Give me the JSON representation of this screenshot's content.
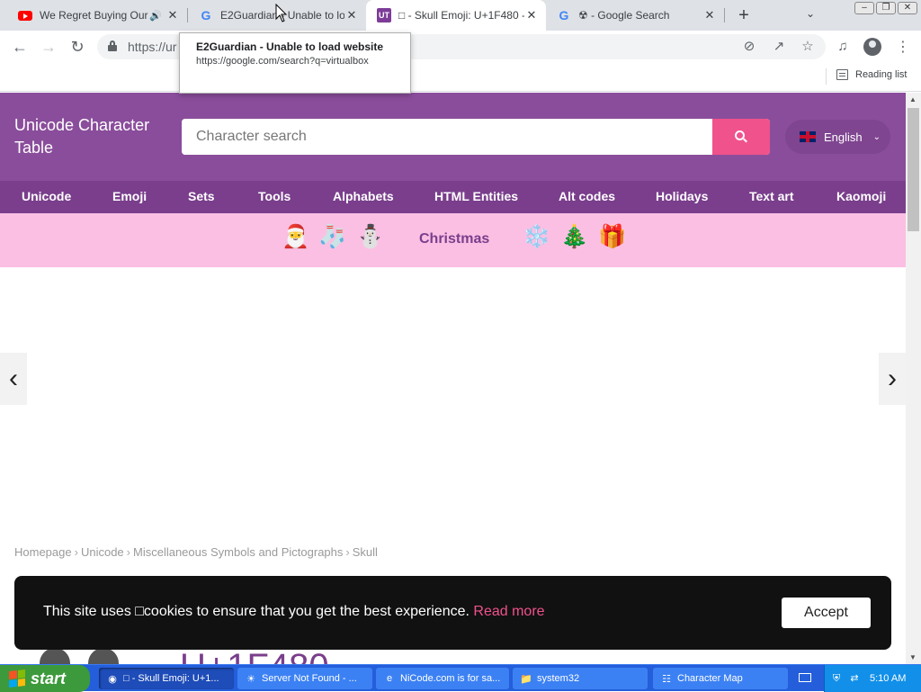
{
  "browser": {
    "tabs": [
      {
        "title": "We Regret Buying Our",
        "favicon": "youtube-icon",
        "audio": true
      },
      {
        "title": "E2Guardian - Unable to load",
        "favicon": "google-icon"
      },
      {
        "title": "□ - Skull Emoji: U+1F480 - ",
        "favicon": "unicode-table-icon",
        "favicon_text": "UT",
        "active": true
      },
      {
        "title": "☢ - Google Search",
        "favicon": "google-icon"
      }
    ],
    "new_tab": "+",
    "url": "https://ur",
    "reading_list": "Reading list",
    "tooltip": {
      "title": "E2Guardian - Unable to load website",
      "url": "https://google.com/search?q=virtualbox"
    }
  },
  "site": {
    "logo": "Unicode Character Table",
    "search_placeholder": "Character search",
    "language": "English",
    "nav": [
      "Unicode",
      "Emoji",
      "Sets",
      "Tools",
      "Alphabets",
      "HTML Entities",
      "Alt codes",
      "Holidays",
      "Text art",
      "Kaomoji"
    ],
    "holiday": {
      "label": "Christmas",
      "emojis_left": [
        "🎅",
        "🧦",
        "⛄"
      ],
      "emojis_right": [
        "❄️",
        "🎄",
        "🎁"
      ]
    },
    "breadcrumb": [
      "Homepage",
      "Unicode",
      "Miscellaneous Symbols and Pictographs",
      "Skull"
    ],
    "breadcrumb_sep": "›",
    "code_peek": "U+1F480",
    "cookie": {
      "text": "This site uses □cookies to ensure that you get the best experience.",
      "link": "Read more",
      "button": "Accept"
    },
    "colors": {
      "header": "#8a4d9b",
      "nav": "#7a3e8c",
      "accent": "#f0528c",
      "banner": "#fbbfe3"
    }
  },
  "taskbar": {
    "start": "start",
    "tasks": [
      {
        "label": "□ - Skull Emoji: U+1...",
        "icon": "chrome-icon",
        "active": true
      },
      {
        "label": "Server Not Found - ...",
        "icon": "firefox-icon"
      },
      {
        "label": "NiCode.com is for sa...",
        "icon": "ie-icon"
      },
      {
        "label": "system32",
        "icon": "folder-icon"
      },
      {
        "label": "Character Map",
        "icon": "charmap-icon"
      }
    ],
    "clock": "5:10 AM"
  }
}
